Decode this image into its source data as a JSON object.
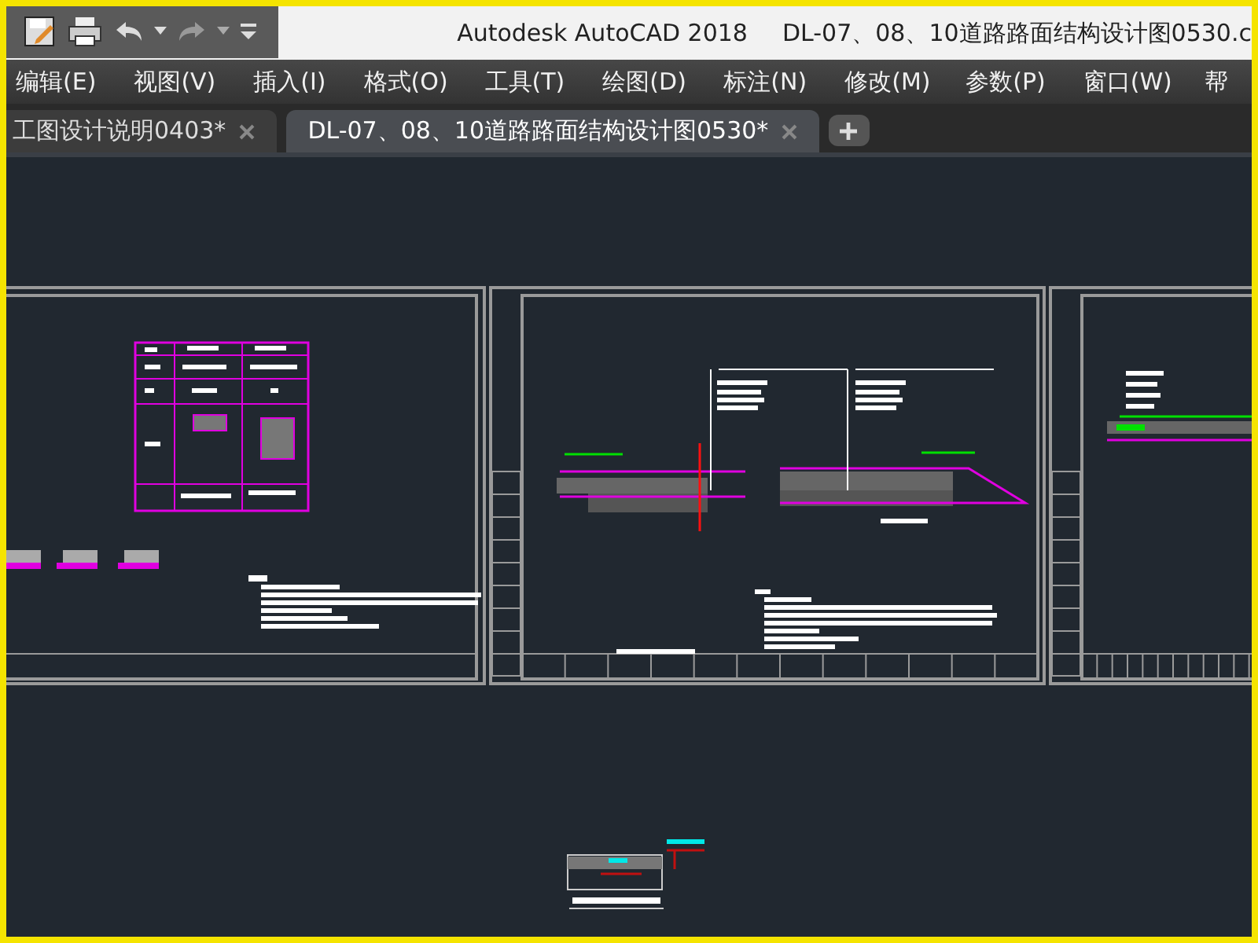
{
  "window": {
    "app_title": "Autodesk AutoCAD 2018",
    "document_title": "DL-07、08、10道路路面结构设计图0530.c"
  },
  "menu": [
    {
      "label": "编辑(E)"
    },
    {
      "label": "视图(V)"
    },
    {
      "label": "插入(I)"
    },
    {
      "label": "格式(O)"
    },
    {
      "label": "工具(T)"
    },
    {
      "label": "绘图(D)"
    },
    {
      "label": "标注(N)"
    },
    {
      "label": "修改(M)"
    },
    {
      "label": "参数(P)"
    },
    {
      "label": "窗口(W)"
    },
    {
      "label": "帮"
    }
  ],
  "tabs": [
    {
      "label": "工图设计说明0403*",
      "selected": false
    },
    {
      "label": "DL-07、08、10道路路面结构设计图0530*",
      "selected": true
    }
  ]
}
